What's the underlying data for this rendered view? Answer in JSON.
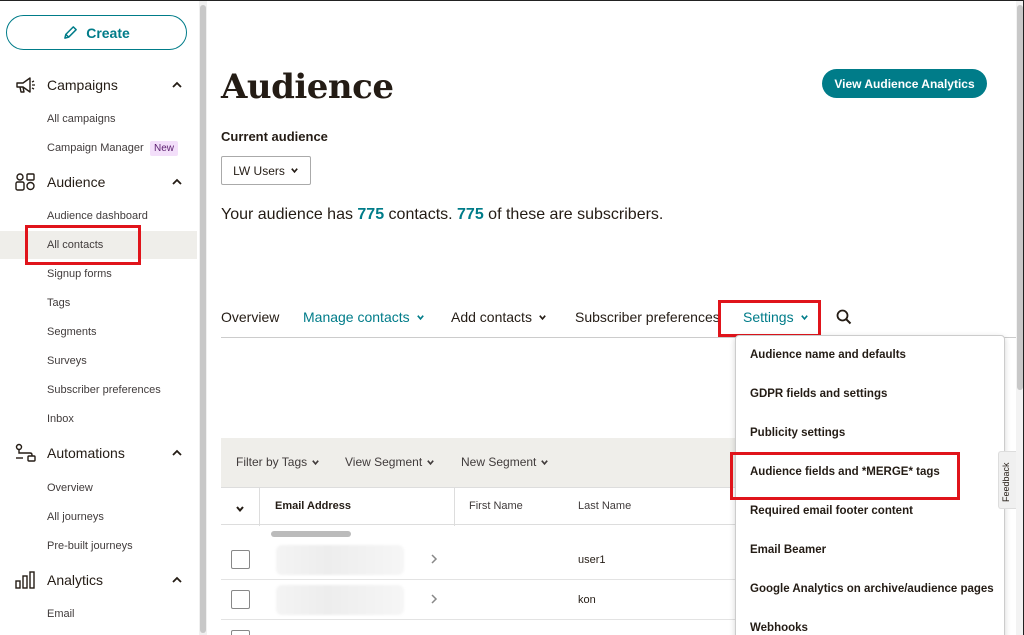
{
  "sidebar": {
    "create_label": "Create",
    "sections": {
      "campaigns": {
        "label": "Campaigns",
        "items": [
          "All campaigns",
          "Campaign Manager"
        ],
        "badge": "New"
      },
      "audience": {
        "label": "Audience",
        "items": [
          "Audience dashboard",
          "All contacts",
          "Signup forms",
          "Tags",
          "Segments",
          "Surveys",
          "Subscriber preferences",
          "Inbox"
        ]
      },
      "automations": {
        "label": "Automations",
        "items": [
          "Overview",
          "All journeys",
          "Pre-built journeys"
        ]
      },
      "analytics": {
        "label": "Analytics",
        "items": [
          "Email"
        ]
      }
    }
  },
  "header": {
    "title": "Audience",
    "analytics_button": "View Audience Analytics",
    "current_audience_label": "Current audience",
    "audience_select": "LW Users"
  },
  "summary": {
    "prefix": "Your audience has ",
    "contacts": "775",
    "middle": " contacts. ",
    "subscribers": "775",
    "suffix": " of these are subscribers."
  },
  "tabs": [
    "Overview",
    "Manage contacts",
    "Add contacts",
    "Subscriber preferences",
    "Settings"
  ],
  "filter_bar": [
    "Filter by Tags",
    "View Segment",
    "New Segment"
  ],
  "table": {
    "columns": [
      "Email Address",
      "First Name",
      "Last Name"
    ],
    "rows": [
      {
        "last_name": "user1"
      },
      {
        "last_name": "kon"
      }
    ]
  },
  "settings_menu": [
    "Audience name and defaults",
    "GDPR fields and settings",
    "Publicity settings",
    "Audience fields and *MERGE* tags",
    "Required email footer content",
    "Email Beamer",
    "Google Analytics on archive/audience pages",
    "Webhooks"
  ],
  "feedback_label": "Feedback",
  "colors": {
    "accent": "#007c89",
    "highlight": "#e0141b",
    "active_bg": "#efeeea"
  }
}
